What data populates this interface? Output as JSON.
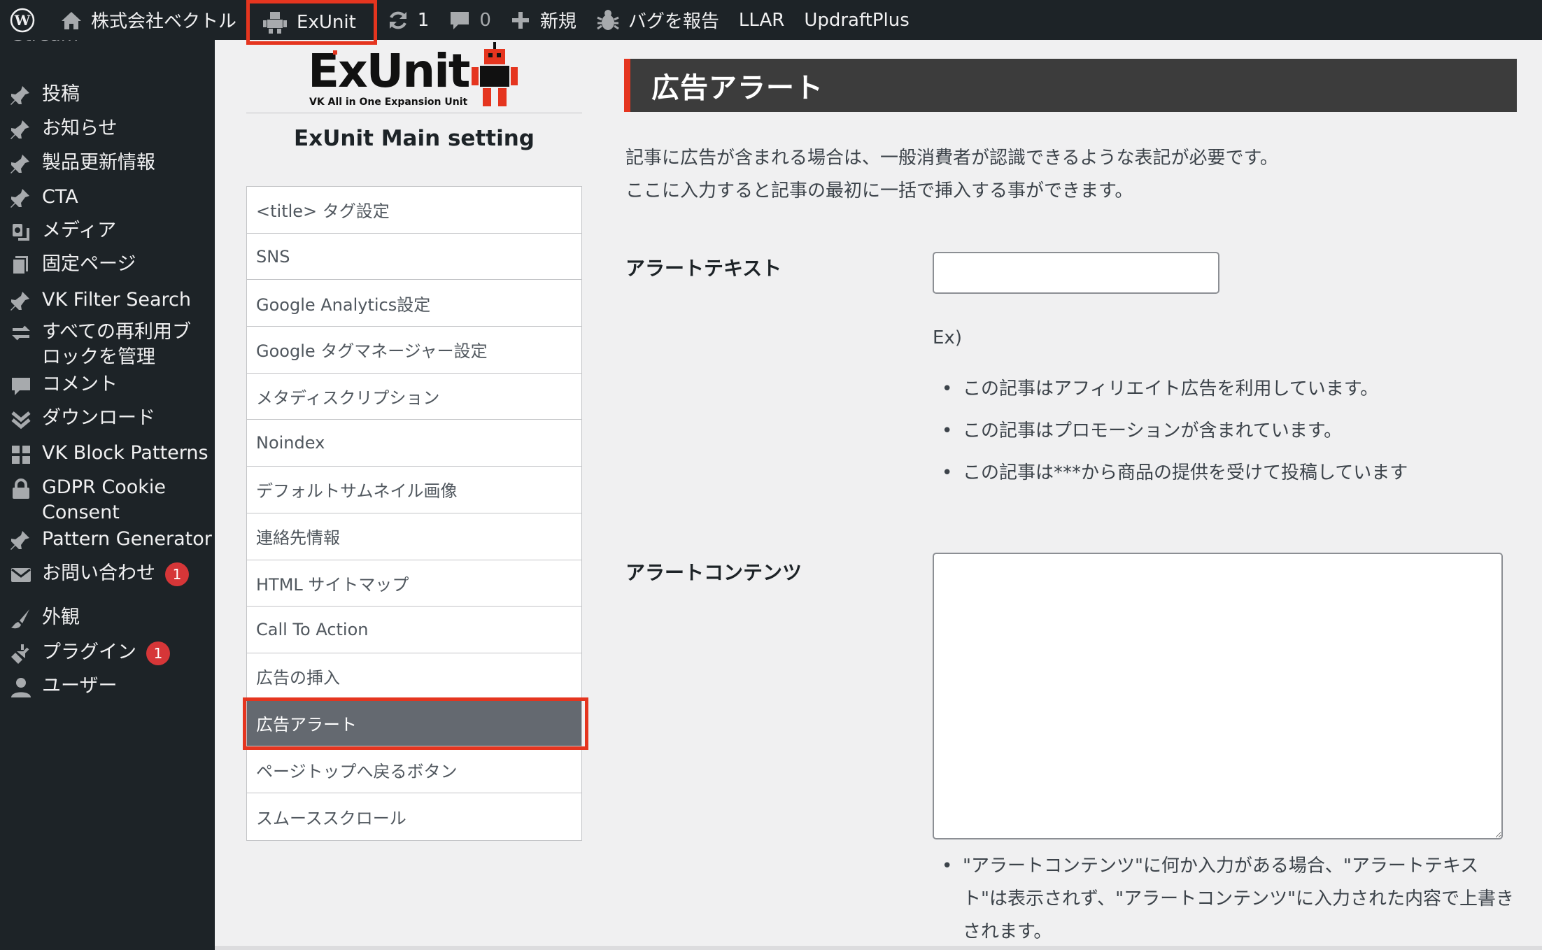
{
  "adminbar": {
    "site_name": "株式会社ベクトル",
    "exunit": "ExUnit",
    "updates_count": "1",
    "comments_count": "0",
    "new_label": "新規",
    "bug_report": "バグを報告",
    "llar": "LLAR",
    "updraftplus": "UpdraftPlus"
  },
  "sidebar": {
    "stub": "Stream",
    "items": [
      {
        "label": "投稿",
        "icon": "pin-icon"
      },
      {
        "label": "お知らせ",
        "icon": "pin-icon"
      },
      {
        "label": "製品更新情報",
        "icon": "pin-icon"
      },
      {
        "label": "CTA",
        "icon": "pin-icon"
      },
      {
        "label": "メディア",
        "icon": "media-icon"
      },
      {
        "label": "固定ページ",
        "icon": "page-icon"
      },
      {
        "label": "VK Filter Search",
        "icon": "pin-icon"
      },
      {
        "label": "すべての再利用ブロックを管理",
        "icon": "reuse-icon"
      },
      {
        "label": "コメント",
        "icon": "comment-icon"
      },
      {
        "label": "ダウンロード",
        "icon": "download-icon"
      },
      {
        "label": "VK Block Patterns",
        "icon": "grid-icon"
      },
      {
        "label": "GDPR Cookie Consent",
        "icon": "lock-icon"
      },
      {
        "label": "Pattern Generator",
        "icon": "pin-icon"
      },
      {
        "label": "お問い合わせ",
        "icon": "mail-icon",
        "badge": "1"
      },
      {
        "label": "外観",
        "icon": "brush-icon"
      },
      {
        "label": "プラグイン",
        "icon": "plugin-icon",
        "badge": "1"
      },
      {
        "label": "ユーザー",
        "icon": "user-icon"
      }
    ]
  },
  "logo": {
    "text": "ExUnit",
    "sub": "VK All in One Expansion Unit"
  },
  "settings_menu": {
    "title": "ExUnit Main setting",
    "items": [
      "<title> タグ設定",
      "SNS",
      "Google Analytics設定",
      "Google タグマネージャー設定",
      "メタディスクリプション",
      "Noindex",
      "デフォルトサムネイル画像",
      "連絡先情報",
      "HTML サイトマップ",
      "Call To Action",
      "広告の挿入",
      "広告アラート",
      "ページトップへ戻るボタン",
      "スムーススクロール"
    ],
    "active_index": 11
  },
  "content": {
    "section_title": "広告アラート",
    "description_line1": "記事に広告が含まれる場合は、一般消費者が認識できるような表記が必要です。",
    "description_line2": "ここに入力すると記事の最初に一括で挿入する事ができます。",
    "alert_text_label": "アラートテキスト",
    "alert_text_value": "",
    "ex_label": "Ex)",
    "examples": [
      "この記事はアフィリエイト広告を利用しています。",
      "この記事はプロモーションが含まれています。",
      "この記事は***から商品の提供を受けて投稿しています"
    ],
    "alert_content_label": "アラートコンテンツ",
    "alert_content_value": "",
    "note": "\"アラートコンテンツ\"に何か入力がある場合、\"アラートテキスト\"は表示されず、\"アラートコンテンツ\"に入力された内容で上書きされます。"
  },
  "colors": {
    "highlight": "#e5351f",
    "adminbar": "#1d2327",
    "badge": "#d63638"
  }
}
